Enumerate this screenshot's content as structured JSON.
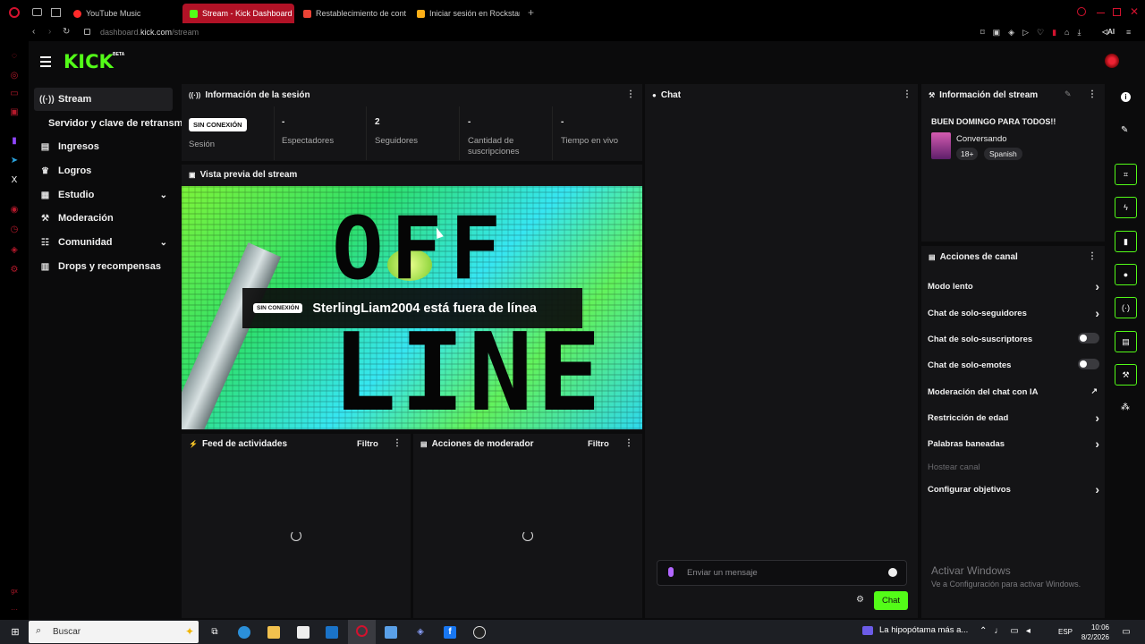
{
  "tabs": [
    {
      "label": "YouTube Music",
      "color": "#ff2a2a"
    },
    {
      "label": "Stream - Kick Dashboard",
      "color": "#53fc18"
    },
    {
      "label": "Restablecimiento de contr",
      "color": "#ea4335"
    },
    {
      "label": "Iniciar sesión en Rockstar",
      "color": "#fcaf17"
    }
  ],
  "address": {
    "prefix": "dashboard.",
    "domain": "kick.com",
    "path": "/stream"
  },
  "header": {
    "logo": "KICK",
    "beta": "BETA"
  },
  "sidebar": {
    "items": [
      {
        "label": "Stream",
        "icon": "broadcast-icon"
      },
      {
        "label": "Servidor y clave de retransmisión",
        "icon": ""
      },
      {
        "label": "Ingresos",
        "icon": "chart-icon"
      },
      {
        "label": "Logros",
        "icon": "trophy-icon"
      },
      {
        "label": "Estudio",
        "icon": "studio-icon"
      },
      {
        "label": "Moderación",
        "icon": "wrench-icon"
      },
      {
        "label": "Comunidad",
        "icon": "people-icon"
      },
      {
        "label": "Drops y recompensas",
        "icon": "gift-icon"
      }
    ]
  },
  "session": {
    "title": "Información de la sesión",
    "status_badge": "SIN CONEXIÓN",
    "stats": [
      {
        "value": "",
        "label": "Sesión"
      },
      {
        "value": "-",
        "label": "Espectadores"
      },
      {
        "value": "2",
        "label": "Seguidores"
      },
      {
        "value": "-",
        "label": "Cantidad de suscripciones"
      },
      {
        "value": "-",
        "label": "Tiempo en vivo"
      }
    ]
  },
  "preview": {
    "title": "Vista previa del stream",
    "badge": "SIN CONEXIÓN",
    "message": "SterlingLiam2004 está fuera de línea",
    "big_text_top": "OFF",
    "big_text_bottom": "LINE"
  },
  "activity": {
    "title": "Feed de actividades",
    "filter": "Filtro"
  },
  "modactions": {
    "title": "Acciones de moderador",
    "filter": "Filtro"
  },
  "chat": {
    "title": "Chat",
    "placeholder": "Enviar un mensaje",
    "send_label": "Chat"
  },
  "stream_info": {
    "title": "Información del stream",
    "stream_title": "BUEN DOMINGO PARA TODOS!!",
    "category": "Conversando",
    "tags": [
      "18+",
      "Spanish"
    ]
  },
  "channel_actions": {
    "title": "Acciones de canal",
    "rows": [
      {
        "label": "Modo lento",
        "control": "chevron"
      },
      {
        "label": "Chat de solo-seguidores",
        "control": "chevron"
      },
      {
        "label": "Chat de solo-suscriptores",
        "control": "toggle"
      },
      {
        "label": "Chat de solo-emotes",
        "control": "toggle"
      },
      {
        "label": "Moderación del chat con IA",
        "control": "external"
      },
      {
        "label": "Restricción de edad",
        "control": "chevron"
      },
      {
        "label": "Palabras baneadas",
        "control": "chevron"
      },
      {
        "label": "Hostear canal",
        "control": "none"
      },
      {
        "label": "Configurar objetivos",
        "control": "chevron"
      }
    ]
  },
  "watermark": {
    "line1": "Activar Windows",
    "line2": "Ve a Configuración para activar Windows."
  },
  "taskbar": {
    "search": "Buscar",
    "notification": "La hipopótama más a...",
    "lang": "ESP",
    "time": "10:06",
    "date": "8/2/2026"
  },
  "colors": {
    "brand": "#53fc18",
    "browser_accent": "#b11226",
    "panel": "#141416",
    "background": "#0b0b0c"
  }
}
